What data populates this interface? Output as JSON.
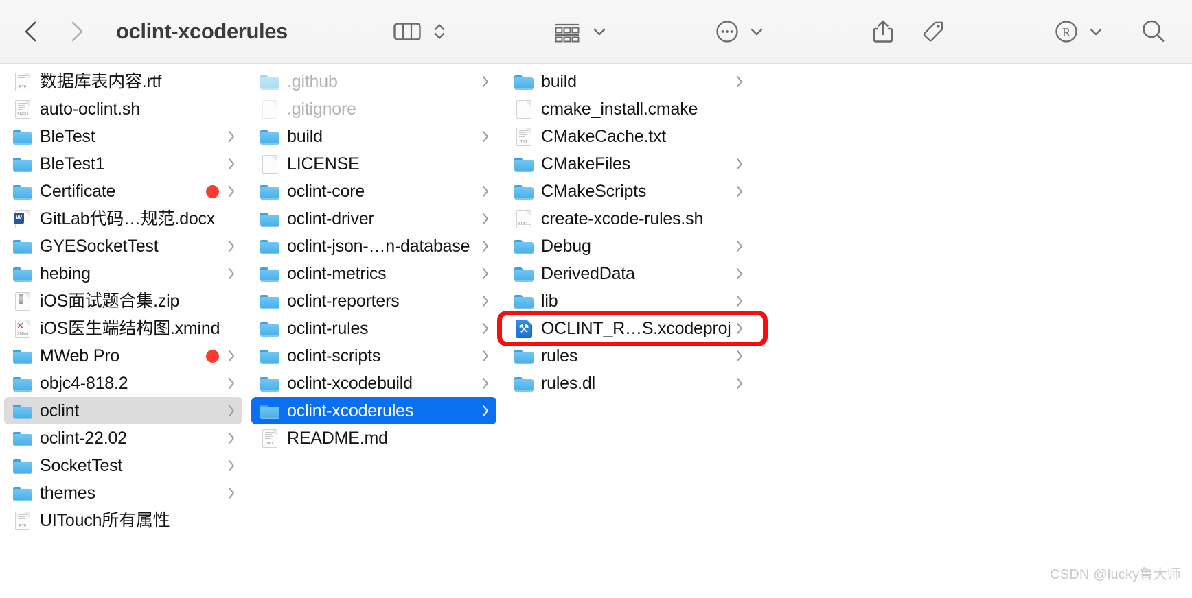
{
  "window": {
    "title": "oclint-xcoderules"
  },
  "toolbar": {
    "back_label": "Back",
    "forward_label": "Forward",
    "view_label": "Column view",
    "view_stepper_label": "Change view",
    "group_label": "Group items",
    "group_chevron_label": "Group options",
    "more_label": "More",
    "more_chevron_label": "More options",
    "share_label": "Share",
    "tag_label": "Edit tags",
    "extension_label": "R",
    "extension_chevron_label": "Extension options",
    "search_label": "Search"
  },
  "columns": [
    {
      "name": "column-1",
      "items": [
        {
          "label": "数据库表内容.rtf",
          "type": "doc",
          "badge": "RTF",
          "disclosure": false,
          "tag": false,
          "selected": "none",
          "dimmed": false
        },
        {
          "label": "auto-oclint.sh",
          "type": "doc",
          "badge": "SHELL",
          "disclosure": false,
          "tag": false,
          "selected": "none",
          "dimmed": false
        },
        {
          "label": "BleTest",
          "type": "folder",
          "badge": "",
          "disclosure": true,
          "tag": false,
          "selected": "none",
          "dimmed": false
        },
        {
          "label": "BleTest1",
          "type": "folder",
          "badge": "",
          "disclosure": true,
          "tag": false,
          "selected": "none",
          "dimmed": false
        },
        {
          "label": "Certificate",
          "type": "folder",
          "badge": "",
          "disclosure": true,
          "tag": true,
          "selected": "none",
          "dimmed": false
        },
        {
          "label": "GitLab代码…规范.docx",
          "type": "docx",
          "badge": "W",
          "disclosure": false,
          "tag": false,
          "selected": "none",
          "dimmed": false
        },
        {
          "label": "GYESocketTest",
          "type": "folder",
          "badge": "",
          "disclosure": true,
          "tag": false,
          "selected": "none",
          "dimmed": false
        },
        {
          "label": "hebing",
          "type": "folder",
          "badge": "",
          "disclosure": true,
          "tag": false,
          "selected": "none",
          "dimmed": false
        },
        {
          "label": "iOS面试题合集.zip",
          "type": "zip",
          "badge": "",
          "disclosure": false,
          "tag": false,
          "selected": "none",
          "dimmed": false
        },
        {
          "label": "iOS医生端结构图.xmind",
          "type": "xmind",
          "badge": "XMind",
          "disclosure": false,
          "tag": false,
          "selected": "none",
          "dimmed": false
        },
        {
          "label": "MWeb Pro",
          "type": "folder",
          "badge": "",
          "disclosure": true,
          "tag": true,
          "selected": "none",
          "dimmed": false
        },
        {
          "label": "objc4-818.2",
          "type": "folder",
          "badge": "",
          "disclosure": true,
          "tag": false,
          "selected": "none",
          "dimmed": false
        },
        {
          "label": "oclint",
          "type": "folder",
          "badge": "",
          "disclosure": true,
          "tag": false,
          "selected": "gray",
          "dimmed": false
        },
        {
          "label": "oclint-22.02",
          "type": "folder",
          "badge": "",
          "disclosure": true,
          "tag": false,
          "selected": "none",
          "dimmed": false
        },
        {
          "label": "SocketTest",
          "type": "folder",
          "badge": "",
          "disclosure": true,
          "tag": false,
          "selected": "none",
          "dimmed": false
        },
        {
          "label": "themes",
          "type": "folder",
          "badge": "",
          "disclosure": true,
          "tag": false,
          "selected": "none",
          "dimmed": false
        },
        {
          "label": "UITouch所有属性",
          "type": "doc",
          "badge": "RTF",
          "disclosure": false,
          "tag": false,
          "selected": "none",
          "dimmed": false
        }
      ]
    },
    {
      "name": "column-2",
      "items": [
        {
          "label": ".github",
          "type": "folder",
          "badge": "",
          "disclosure": true,
          "tag": false,
          "selected": "none",
          "dimmed": true
        },
        {
          "label": ".gitignore",
          "type": "doc",
          "badge": "",
          "disclosure": false,
          "tag": false,
          "selected": "none",
          "dimmed": true
        },
        {
          "label": "build",
          "type": "folder",
          "badge": "",
          "disclosure": true,
          "tag": false,
          "selected": "none",
          "dimmed": false
        },
        {
          "label": "LICENSE",
          "type": "doc",
          "badge": "",
          "disclosure": false,
          "tag": false,
          "selected": "none",
          "dimmed": false
        },
        {
          "label": "oclint-core",
          "type": "folder",
          "badge": "",
          "disclosure": true,
          "tag": false,
          "selected": "none",
          "dimmed": false
        },
        {
          "label": "oclint-driver",
          "type": "folder",
          "badge": "",
          "disclosure": true,
          "tag": false,
          "selected": "none",
          "dimmed": false
        },
        {
          "label": "oclint-json-…n-database",
          "type": "folder",
          "badge": "",
          "disclosure": true,
          "tag": false,
          "selected": "none",
          "dimmed": false
        },
        {
          "label": "oclint-metrics",
          "type": "folder",
          "badge": "",
          "disclosure": true,
          "tag": false,
          "selected": "none",
          "dimmed": false
        },
        {
          "label": "oclint-reporters",
          "type": "folder",
          "badge": "",
          "disclosure": true,
          "tag": false,
          "selected": "none",
          "dimmed": false
        },
        {
          "label": "oclint-rules",
          "type": "folder",
          "badge": "",
          "disclosure": true,
          "tag": false,
          "selected": "none",
          "dimmed": false
        },
        {
          "label": "oclint-scripts",
          "type": "folder",
          "badge": "",
          "disclosure": true,
          "tag": false,
          "selected": "none",
          "dimmed": false
        },
        {
          "label": "oclint-xcodebuild",
          "type": "folder",
          "badge": "",
          "disclosure": true,
          "tag": false,
          "selected": "none",
          "dimmed": false
        },
        {
          "label": "oclint-xcoderules",
          "type": "folder",
          "badge": "",
          "disclosure": true,
          "tag": false,
          "selected": "blue",
          "dimmed": false
        },
        {
          "label": "README.md",
          "type": "doc",
          "badge": "MD",
          "disclosure": false,
          "tag": false,
          "selected": "none",
          "dimmed": false
        }
      ]
    },
    {
      "name": "column-3",
      "items": [
        {
          "label": "build",
          "type": "folder",
          "badge": "",
          "disclosure": true,
          "tag": false,
          "selected": "none",
          "dimmed": false
        },
        {
          "label": "cmake_install.cmake",
          "type": "doc",
          "badge": "",
          "disclosure": false,
          "tag": false,
          "selected": "none",
          "dimmed": false
        },
        {
          "label": "CMakeCache.txt",
          "type": "doc",
          "badge": "TXT",
          "disclosure": false,
          "tag": false,
          "selected": "none",
          "dimmed": false
        },
        {
          "label": "CMakeFiles",
          "type": "folder",
          "badge": "",
          "disclosure": true,
          "tag": false,
          "selected": "none",
          "dimmed": false
        },
        {
          "label": "CMakeScripts",
          "type": "folder",
          "badge": "",
          "disclosure": true,
          "tag": false,
          "selected": "none",
          "dimmed": false
        },
        {
          "label": "create-xcode-rules.sh",
          "type": "doc",
          "badge": "SHELL",
          "disclosure": false,
          "tag": false,
          "selected": "none",
          "dimmed": false
        },
        {
          "label": "Debug",
          "type": "folder",
          "badge": "",
          "disclosure": true,
          "tag": false,
          "selected": "none",
          "dimmed": false
        },
        {
          "label": "DerivedData",
          "type": "folder",
          "badge": "",
          "disclosure": true,
          "tag": false,
          "selected": "none",
          "dimmed": false
        },
        {
          "label": "lib",
          "type": "folder",
          "badge": "",
          "disclosure": true,
          "tag": false,
          "selected": "none",
          "dimmed": false
        },
        {
          "label": "OCLINT_R…S.xcodeproj",
          "type": "xcodeproj",
          "badge": "",
          "disclosure": true,
          "tag": false,
          "selected": "none",
          "dimmed": false
        },
        {
          "label": "rules",
          "type": "folder",
          "badge": "",
          "disclosure": true,
          "tag": false,
          "selected": "none",
          "dimmed": false
        },
        {
          "label": "rules.dl",
          "type": "folder",
          "badge": "",
          "disclosure": true,
          "tag": false,
          "selected": "none",
          "dimmed": false
        }
      ]
    },
    {
      "name": "column-4",
      "items": []
    }
  ],
  "annotation": {
    "target_label": "OCLINT_R…S.xcodeproj",
    "color": "#fb0d0d"
  },
  "watermark": {
    "text": "CSDN @lucky鲁大师"
  },
  "colors": {
    "selection_blue": "#0a6ff0",
    "selection_gray": "#dcdcdc",
    "tag_red": "#ff3b30",
    "folder_blue": "#5cbbee",
    "annotation_red": "#fb0d0d"
  }
}
